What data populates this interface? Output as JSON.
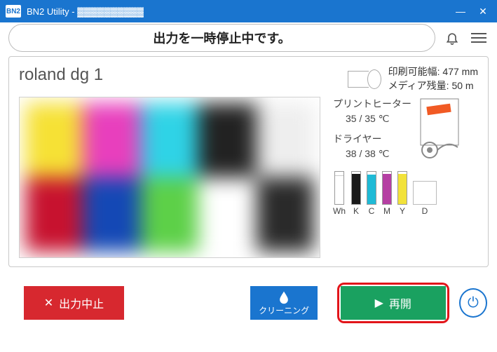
{
  "titlebar": {
    "logo": "BN2",
    "title": "BN2 Utility - ▓▓▓▓▓▓▓▓▓▓"
  },
  "status": {
    "message": "出力を一時停止中です。"
  },
  "device": {
    "name": "roland dg 1"
  },
  "media": {
    "width_label": "印刷可能幅: 477 mm",
    "remain_label": "メディア残量: 50 m"
  },
  "heater": {
    "print_label": "プリントヒーター",
    "print_val": "35 / 35 ℃",
    "dryer_label": "ドライヤー",
    "dryer_val": "38 / 38 ℃"
  },
  "inks": {
    "items": [
      {
        "label": "Wh",
        "color": "#ffffff",
        "level": 90
      },
      {
        "label": "K",
        "color": "#1a1a1a",
        "level": 95
      },
      {
        "label": "C",
        "color": "#1fbad6",
        "level": 92
      },
      {
        "label": "M",
        "color": "#b53fa3",
        "level": 94
      },
      {
        "label": "Y",
        "color": "#f2e23a",
        "level": 93
      }
    ],
    "aux_label": "D"
  },
  "actions": {
    "stop": "出力中止",
    "clean": "クリーニング",
    "resume": "再開"
  }
}
